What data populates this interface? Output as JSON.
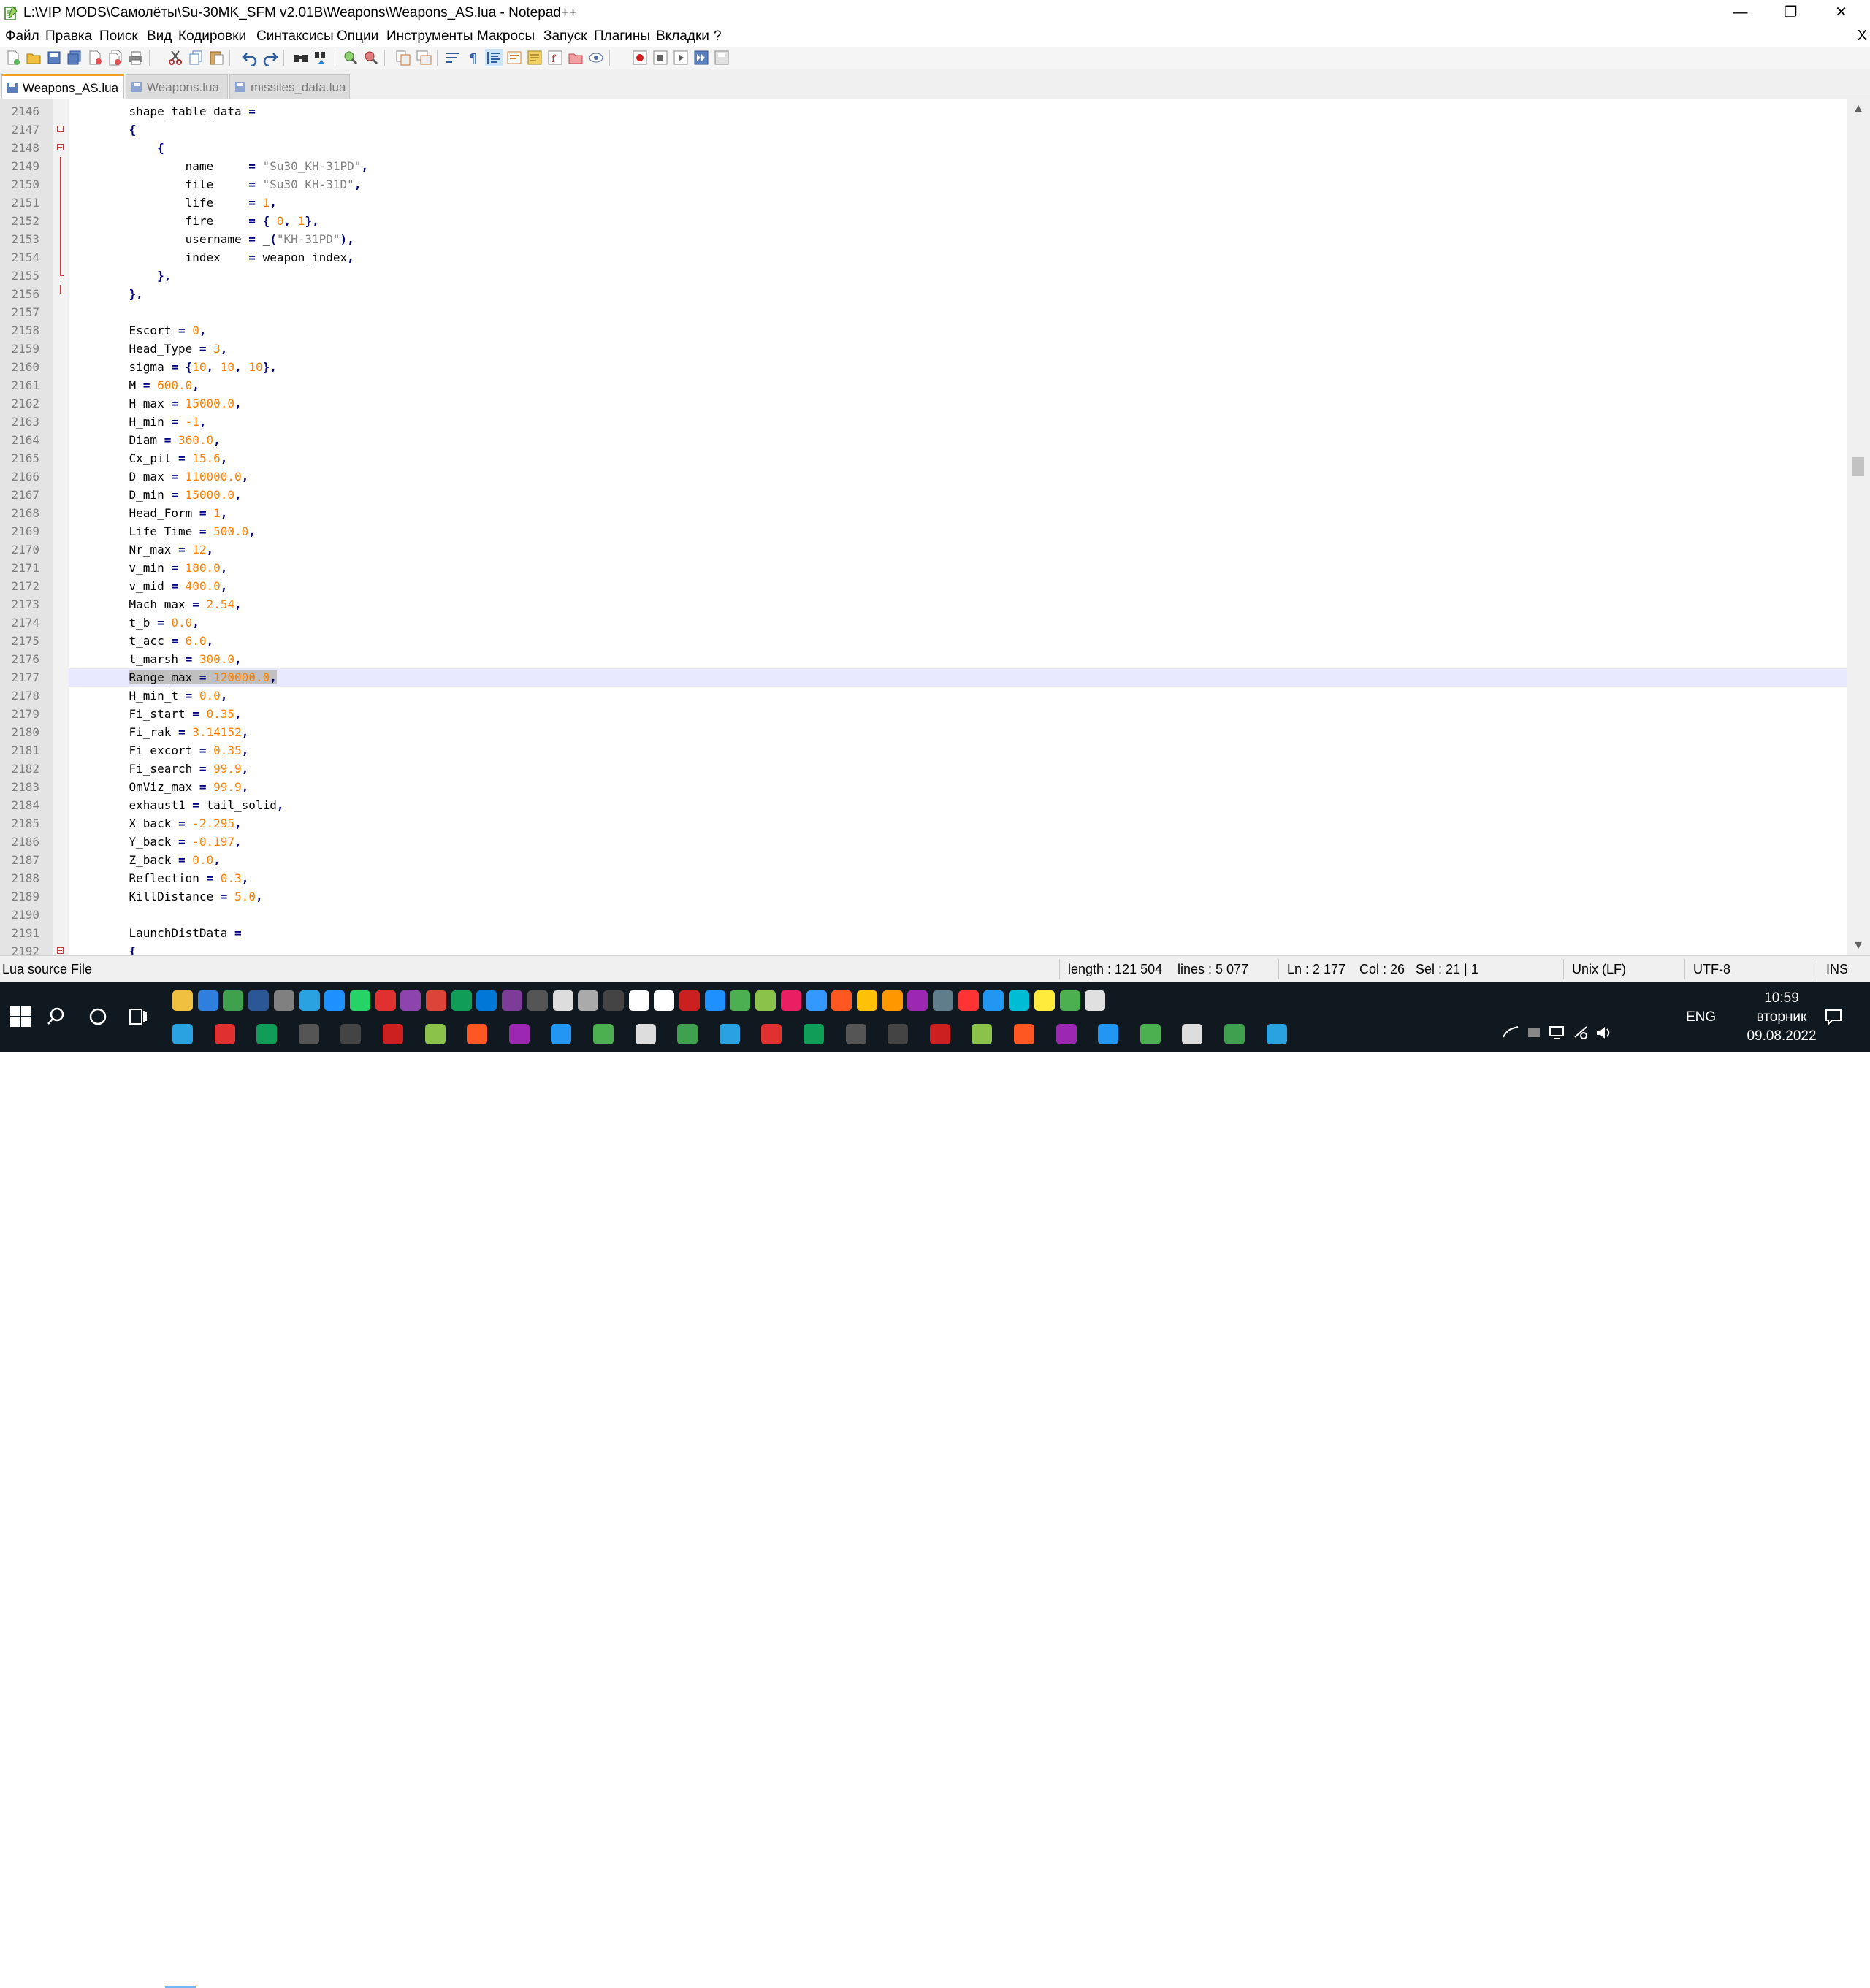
{
  "window": {
    "title": "L:\\VIP MODS\\Самолёты\\Su-30MK_SFM v2.01B\\Weapons\\Weapons_AS.lua - Notepad++",
    "minimize_glyph": "—",
    "maximize_glyph": "❐",
    "close_glyph": "✕"
  },
  "menu": {
    "items": [
      "Файл",
      "Правка",
      "Поиск",
      "Вид",
      "Кодировки",
      "Синтаксисы",
      "Опции",
      "Инструменты",
      "Макросы",
      "Запуск",
      "Плагины",
      "Вкладки",
      "?"
    ],
    "close_glyph": "X"
  },
  "tabs": [
    {
      "label": "Weapons_AS.lua",
      "active": true
    },
    {
      "label": "Weapons.lua",
      "active": false
    },
    {
      "label": "missiles_data.lua",
      "active": false
    }
  ],
  "editor": {
    "current_line": 2177,
    "lines": [
      {
        "n": "2146",
        "t": "    shape_table_data ="
      },
      {
        "n": "2147",
        "t": "    {"
      },
      {
        "n": "2148",
        "t": "        {"
      },
      {
        "n": "2149",
        "t": "            name     = \"Su30_KH-31PD\","
      },
      {
        "n": "2150",
        "t": "            file     = \"Su30_KH-31D\","
      },
      {
        "n": "2151",
        "t": "            life     = 1,"
      },
      {
        "n": "2152",
        "t": "            fire     = { 0, 1},"
      },
      {
        "n": "2153",
        "t": "            username = _(\"KH-31PD\"),"
      },
      {
        "n": "2154",
        "t": "            index    = weapon_index,"
      },
      {
        "n": "2155",
        "t": "        },"
      },
      {
        "n": "2156",
        "t": "    },"
      },
      {
        "n": "2157",
        "t": ""
      },
      {
        "n": "2158",
        "t": "    Escort = 0,"
      },
      {
        "n": "2159",
        "t": "    Head_Type = 3,"
      },
      {
        "n": "2160",
        "t": "    sigma = {10, 10, 10},"
      },
      {
        "n": "2161",
        "t": "    M = 600.0,"
      },
      {
        "n": "2162",
        "t": "    H_max = 15000.0,"
      },
      {
        "n": "2163",
        "t": "    H_min = -1,"
      },
      {
        "n": "2164",
        "t": "    Diam = 360.0,"
      },
      {
        "n": "2165",
        "t": "    Cx_pil = 15.6,"
      },
      {
        "n": "2166",
        "t": "    D_max = 110000.0,"
      },
      {
        "n": "2167",
        "t": "    D_min = 15000.0,"
      },
      {
        "n": "2168",
        "t": "    Head_Form = 1,"
      },
      {
        "n": "2169",
        "t": "    Life_Time = 500.0,"
      },
      {
        "n": "2170",
        "t": "    Nr_max = 12,"
      },
      {
        "n": "2171",
        "t": "    v_min = 180.0,"
      },
      {
        "n": "2172",
        "t": "    v_mid = 400.0,"
      },
      {
        "n": "2173",
        "t": "    Mach_max = 2.54,"
      },
      {
        "n": "2174",
        "t": "    t_b = 0.0,"
      },
      {
        "n": "2175",
        "t": "    t_acc = 6.0,"
      },
      {
        "n": "2176",
        "t": "    t_marsh = 300.0,"
      },
      {
        "n": "2177",
        "t": "    Range_max = 120000.0,"
      },
      {
        "n": "2178",
        "t": "    H_min_t = 0.0,"
      },
      {
        "n": "2179",
        "t": "    Fi_start = 0.35,"
      },
      {
        "n": "2180",
        "t": "    Fi_rak = 3.14152,"
      },
      {
        "n": "2181",
        "t": "    Fi_excort = 0.35,"
      },
      {
        "n": "2182",
        "t": "    Fi_search = 99.9,"
      },
      {
        "n": "2183",
        "t": "    OmViz_max = 99.9,"
      },
      {
        "n": "2184",
        "t": "    exhaust1 = tail_solid,"
      },
      {
        "n": "2185",
        "t": "    X_back = -2.295,"
      },
      {
        "n": "2186",
        "t": "    Y_back = -0.197,"
      },
      {
        "n": "2187",
        "t": "    Z_back = 0.0,"
      },
      {
        "n": "2188",
        "t": "    Reflection = 0.3,"
      },
      {
        "n": "2189",
        "t": "    KillDistance = 5.0,"
      },
      {
        "n": "2190",
        "t": ""
      },
      {
        "n": "2191",
        "t": "    LaunchDistData ="
      },
      {
        "n": "2192",
        "t": "    {"
      }
    ]
  },
  "status": {
    "file_type": "Lua source File",
    "length": "length : 121 504",
    "lines": "lines : 5 077",
    "ln": "Ln : 2 177",
    "col": "Col : 26",
    "sel": "Sel : 21 | 1",
    "eol": "Unix (LF)",
    "encoding": "UTF-8",
    "mode": "INS"
  },
  "taskbar": {
    "language": "ENG",
    "time": "10:59",
    "weekday": "вторник",
    "date": "09.08.2022",
    "colors": {
      "bg": "#101820",
      "accent": "#78b4f0"
    }
  }
}
